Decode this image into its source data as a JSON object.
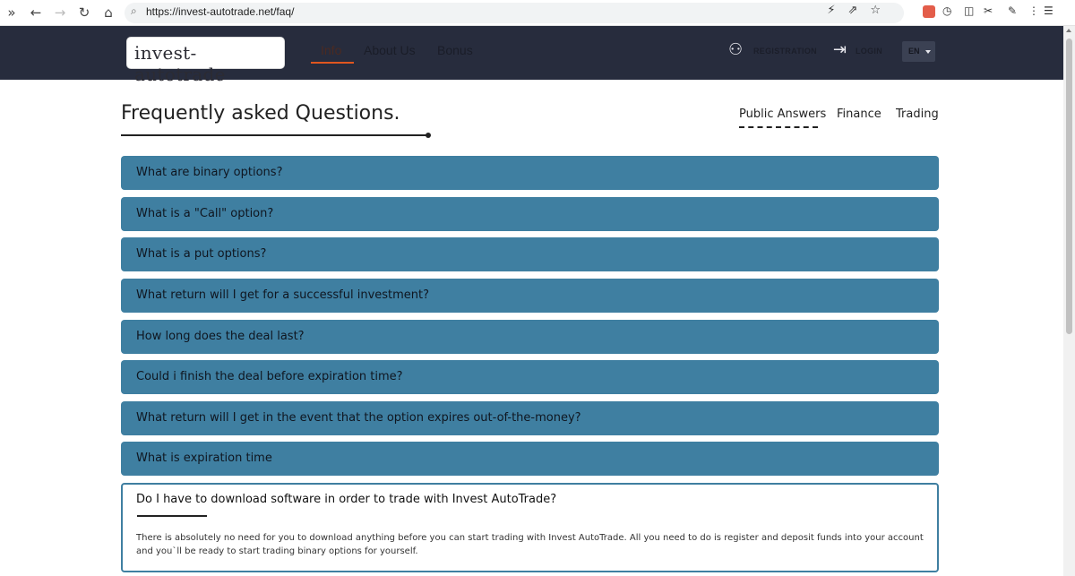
{
  "browser": {
    "url": "https://invest-autotrade.net/faq/"
  },
  "header": {
    "logo_text": "invest-autotrade",
    "menu": [
      {
        "label": "Info"
      },
      {
        "label": "About Us"
      },
      {
        "label": "Bonus"
      }
    ],
    "registration_label": "REGISTRATION",
    "login_label": "LOGIN",
    "language": "EN"
  },
  "main": {
    "title": "Frequently asked Questions.",
    "tabs": [
      {
        "label": "Public Answers"
      },
      {
        "label": "Finance"
      },
      {
        "label": "Trading"
      }
    ],
    "faq": [
      {
        "question": "What are binary options?"
      },
      {
        "question": "What is a \"Call\" option?"
      },
      {
        "question": "What is a put options?"
      },
      {
        "question": "What return will I get for a successful investment?"
      },
      {
        "question": "How long does the deal last?"
      },
      {
        "question": "Could i finish the deal before expiration time?"
      },
      {
        "question": "What return will I get in the event that the option expires out-of-the-money?"
      },
      {
        "question": "What is expiration time"
      }
    ],
    "open_faq": {
      "question": "Do I have to download software in order to trade with Invest AutoTrade?",
      "answer": "There is absolutely no need for you to download anything before you can start trading with Invest AutoTrade. All you need to do is register and deposit funds into your account and you`ll be ready to start trading binary options for yourself."
    }
  },
  "colors": {
    "header_bg": "#272c3d",
    "accent": "#e0561f",
    "faq_bg": "#3f7fa1"
  }
}
